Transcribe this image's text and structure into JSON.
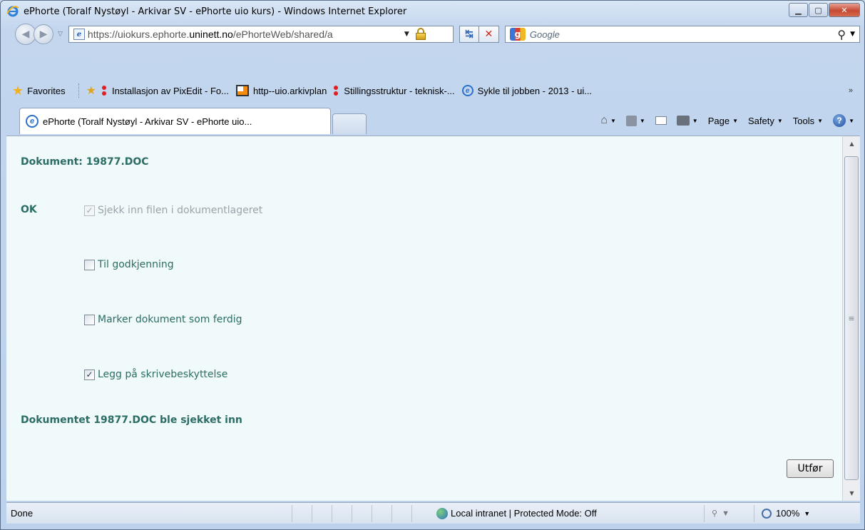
{
  "window": {
    "title": "ePhorte (Toralf Nystøyl - Arkivar SV - ePhorte uio kurs) - Windows Internet Explorer"
  },
  "address_bar": {
    "url_prefix": "https://uiokurs.ephorte.",
    "url_domain": "uninett.no",
    "url_suffix": "/ePhorteWeb/shared/a",
    "search_placeholder": "Google"
  },
  "favorites_bar": {
    "favorites_label": "Favorites",
    "links": [
      "Installasjon av PixEdit - Fo...",
      "http--uio.arkivplan",
      "Stillingsstruktur - teknisk-...",
      "Sykle til jobben - 2013 - ui..."
    ]
  },
  "tabs": {
    "active_tab": "ePhorte (Toralf Nystøyl - Arkivar SV - ePhorte uio..."
  },
  "command_bar": {
    "page": "Page",
    "safety": "Safety",
    "tools": "Tools"
  },
  "content": {
    "document_heading": "Dokument: 19877.DOC",
    "status_ok": "OK",
    "options": [
      {
        "label": "Sjekk inn filen i dokumentlageret",
        "checked": true,
        "disabled": true
      },
      {
        "label": "Til godkjenning",
        "checked": false,
        "disabled": false
      },
      {
        "label": "Marker dokument som ferdig",
        "checked": false,
        "disabled": false
      },
      {
        "label": "Legg på skrivebeskyttelse",
        "checked": true,
        "disabled": false
      }
    ],
    "result_message": "Dokumentet 19877.DOC ble sjekket inn",
    "submit_label": "Utfør"
  },
  "status_bar": {
    "status": "Done",
    "zone": "Local intranet | Protected Mode: Off",
    "zoom": "100%"
  },
  "colors": {
    "content_text": "#2b6d64",
    "content_background": "#f0fafa"
  }
}
